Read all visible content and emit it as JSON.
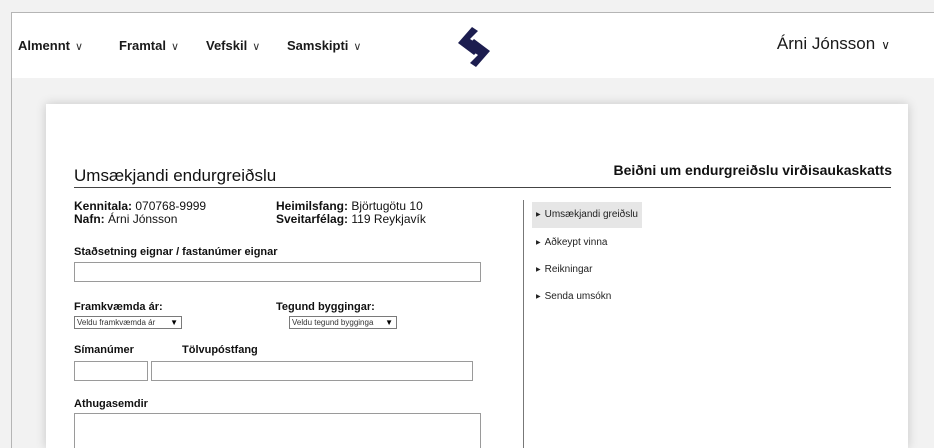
{
  "topbar": {
    "nav": [
      {
        "label": "Almennt"
      },
      {
        "label": "Framtal"
      },
      {
        "label": "Vefskil"
      },
      {
        "label": "Samskipti"
      }
    ],
    "user_name": "Árni Jónsson"
  },
  "form": {
    "title": "Umsækjandi endurgreiðslu",
    "subtitle": "Beiðni um endurgreiðslu virðisaukaskatts",
    "kennitala_label": "Kennitala:",
    "kennitala_value": "070768-9999",
    "nafn_label": "Nafn:",
    "nafn_value": "Árni Jónsson",
    "heimilisfang_label": "Heimilsfang:",
    "heimilisfang_value": "Björtugötu 10",
    "sveitarfelag_label": "Sveitarfélag:",
    "sveitarfelag_value": "119 Reykjavík",
    "location_label": "Staðsetning eignar / fastanúmer eignar",
    "year_label": "Framkvæmda ár:",
    "year_select": "Veldu framkvæmda ár",
    "type_label": "Tegund byggingar:",
    "type_select": "Veldu tegund bygginga",
    "phone_label": "Símanúmer",
    "email_label": "Tölvupóstfang",
    "notes_label": "Athugasemdir"
  },
  "sidebar": {
    "items": [
      {
        "label": "Umsækjandi greiðslu",
        "active": true
      },
      {
        "label": "Aðkeypt vinna",
        "active": false
      },
      {
        "label": "Reikningar",
        "active": false
      },
      {
        "label": "Senda umsókn",
        "active": false
      }
    ]
  },
  "colors": {
    "logo": "#1c1d4f",
    "accent_bg": "#e6e6e6"
  }
}
